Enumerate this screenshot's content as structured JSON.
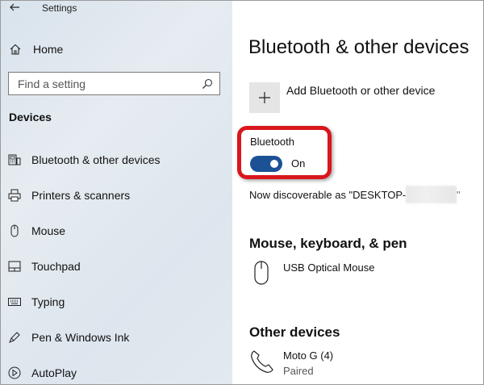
{
  "window": {
    "title": "Settings"
  },
  "sidebar": {
    "home_label": "Home",
    "search": {
      "placeholder": "Find a setting"
    },
    "section_heading": "Devices",
    "items": [
      {
        "label": "Bluetooth & other devices",
        "icon": "bluetooth-devices-icon"
      },
      {
        "label": "Printers & scanners",
        "icon": "printer-icon"
      },
      {
        "label": "Mouse",
        "icon": "mouse-icon"
      },
      {
        "label": "Touchpad",
        "icon": "touchpad-icon"
      },
      {
        "label": "Typing",
        "icon": "keyboard-icon"
      },
      {
        "label": "Pen & Windows Ink",
        "icon": "pen-icon"
      },
      {
        "label": "AutoPlay",
        "icon": "autoplay-icon"
      }
    ]
  },
  "main": {
    "title": "Bluetooth & other devices",
    "add_device_label": "Add Bluetooth or other device",
    "bluetooth": {
      "label": "Bluetooth",
      "toggle_state": "On",
      "discoverable_text": "Now discoverable as \"DESKTOP-",
      "discoverable_tail": "\""
    },
    "mouse_section": {
      "heading": "Mouse, keyboard, & pen",
      "devices": [
        {
          "name": "USB Optical Mouse",
          "status": "",
          "icon": "mouse-icon"
        }
      ]
    },
    "other_section": {
      "heading": "Other devices",
      "devices": [
        {
          "name": "Moto G (4)",
          "status": "Paired",
          "icon": "phone-icon"
        }
      ]
    }
  },
  "colors": {
    "accent": "#1d5196",
    "highlight_border": "#d9161c",
    "sidebar_bg": "#dfe7ee",
    "add_tile_bg": "#e5e5e5"
  }
}
